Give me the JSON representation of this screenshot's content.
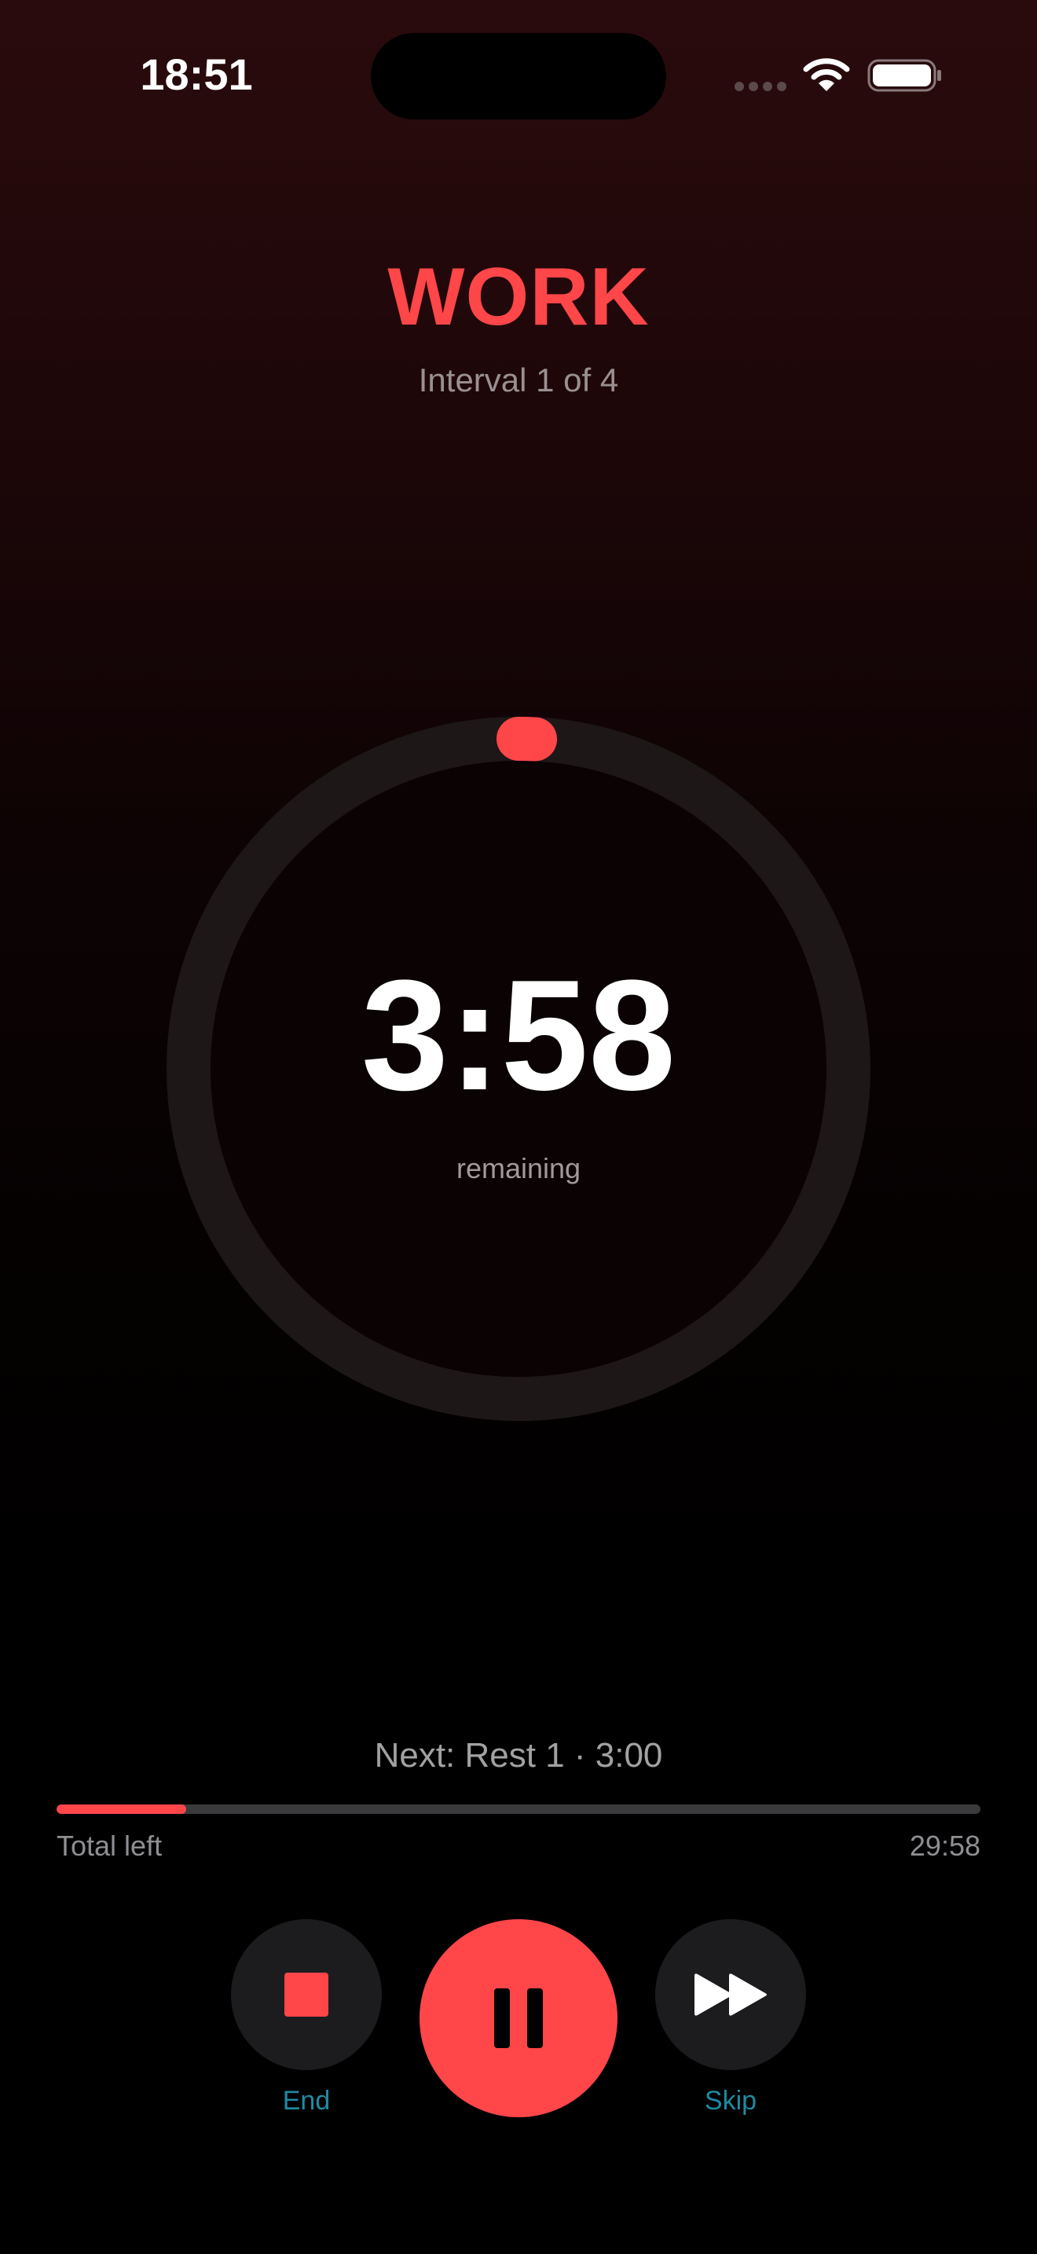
{
  "status_bar": {
    "time": "18:51"
  },
  "workout": {
    "phase": "WORK",
    "interval": "Interval 1 of 4",
    "time_remaining": "3:58",
    "remaining_caption": "remaining",
    "ring_progress_fraction": 0.008
  },
  "next_up": {
    "label": "Next: Rest 1 · 3:00"
  },
  "total": {
    "label": "Total left",
    "value": "29:58",
    "progress_fraction": 0.14
  },
  "controls": {
    "end_label": "End",
    "skip_label": "Skip",
    "end_icon": "stop-icon",
    "pause_icon": "pause-icon",
    "skip_icon": "fast-forward-icon"
  },
  "colors": {
    "accent": "#ff4649",
    "ring_track": "#1d1718",
    "control_label": "#1f8aa3"
  }
}
